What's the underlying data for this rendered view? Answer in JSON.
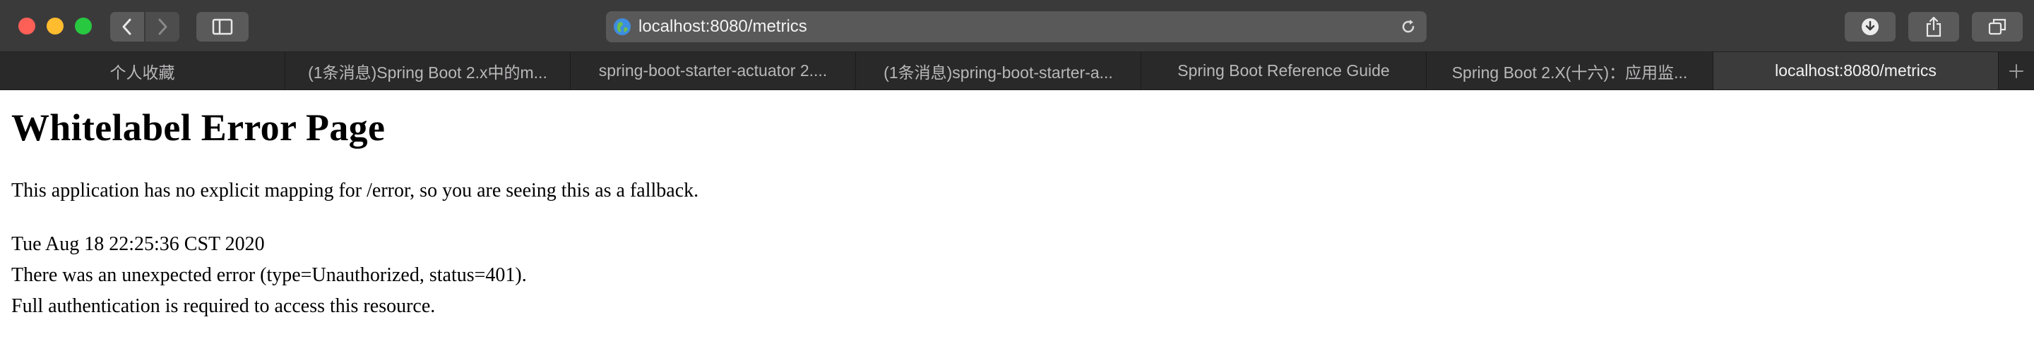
{
  "browser": {
    "url": "localhost:8080/metrics",
    "tabs": [
      {
        "label": "个人收藏",
        "active": false
      },
      {
        "label": "(1条消息)Spring Boot 2.x中的m...",
        "active": false
      },
      {
        "label": "spring-boot-starter-actuator 2....",
        "active": false
      },
      {
        "label": "(1条消息)spring-boot-starter-a...",
        "active": false
      },
      {
        "label": "Spring Boot Reference Guide",
        "active": false
      },
      {
        "label": "Spring Boot 2.X(十六)：应用监...",
        "active": false
      },
      {
        "label": "localhost:8080/metrics",
        "active": true
      }
    ],
    "icons": {
      "back": "chevron-left-icon",
      "forward": "chevron-right-icon",
      "sidebar": "sidebar-icon",
      "globe": "globe-icon",
      "reload": "reload-icon",
      "download": "download-icon",
      "share": "share-icon",
      "tabs": "tab-overview-icon",
      "new_tab": "plus-icon"
    },
    "colors": {
      "close": "#fe5f57",
      "minimize": "#febc2e",
      "maximize": "#28c840",
      "active_tab": "#3c3b3c"
    }
  },
  "page": {
    "title": "Whitelabel Error Page",
    "intro": "This application has no explicit mapping for /error, so you are seeing this as a fallback.",
    "timestamp": "Tue Aug 18 22:25:36 CST 2020",
    "error_line": "There was an unexpected error (type=Unauthorized, status=401).",
    "detail_line": "Full authentication is required to access this resource."
  }
}
